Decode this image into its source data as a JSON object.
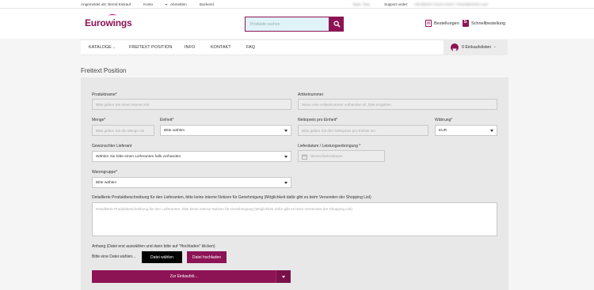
{
  "topbar": {
    "logged_in_as": "Angemeldet als: Bernd Einkauf",
    "konto": "Konto",
    "abmelden": "Abmelden",
    "backend": "Backend",
    "support_name": "Baar, Test,",
    "support_label": "Support under:",
    "support_contact": "+49 (0)XXX XXXX XXXX / XXXX@XXXX.com"
  },
  "header": {
    "logo_text": "Eurowings",
    "search_placeholder": "Produkte suchen",
    "bestellungen": "Bestellungen",
    "schnellbestellung": "Schnellbestellung"
  },
  "nav": {
    "items": [
      "KATALOGE",
      "FREITEXT POSITION",
      "INFO",
      "KONTAKT",
      "FAQ"
    ],
    "cart_label": "0 Einkaufslisten"
  },
  "page": {
    "title": "Freitext Position"
  },
  "form": {
    "produktname_label": "Produktname*",
    "produktname_placeholder": "Bitte geben Sie einen Namen ein",
    "artikelnummer_label": "Artikelnummer",
    "artikelnummer_placeholder": "Wenn eine Artikelnummer vorhanden ist, bitte eingeben",
    "menge_label": "Menge*",
    "menge_placeholder": "Bitte geben Sie die Menge ein",
    "einheit_label": "Einheit*",
    "einheit_value": "Bitte wählen",
    "nettopreis_label": "Nettopreis pro Einheit*",
    "nettopreis_placeholder": "Bitte geben Sie den Nettopreis pro Einheit ein",
    "waehrung_label": "Währung*",
    "waehrung_value": "EUR",
    "lieferant_label": "Gewünschter Lieferant",
    "lieferant_value": "Wählen Sie bitte einen Lieferanten falls vorhanden",
    "lieferdatum_label": "Lieferdatum / Leistungserbringung *",
    "lieferdatum_placeholder": "Wunschliefertdatum",
    "warengruppe_label": "Warengruppe*",
    "warengruppe_value": "Bitte wählen",
    "beschreibung_label": "Detaillierte Produktbeschreibung für den Lieferanten, bitte keine interne Notizen für Genehmigung (Möglichkeit dafür gibt es beim Versenden der Shopping List)",
    "beschreibung_placeholder": "Detaillierte Produktbeschreibung für den Lieferanten, bitte keine interne Notizen für Genehmigung (Möglichkeit dafür gibt es beim Versenden der Shopping List)",
    "anhang_label": "Anhang (Datei erst auswählen und dann bitte auf \"Hochladen\" klicken)",
    "no_file_text": "Bitte eine Datei wählen...",
    "file_button": "Datei wählen",
    "upload_button": "Datei hochladen",
    "submit_button": "Zur Einkaufsli..."
  },
  "colors": {
    "brand": "#8c1455",
    "accent": "#d4006a",
    "search_bg": "#dff3f8"
  }
}
